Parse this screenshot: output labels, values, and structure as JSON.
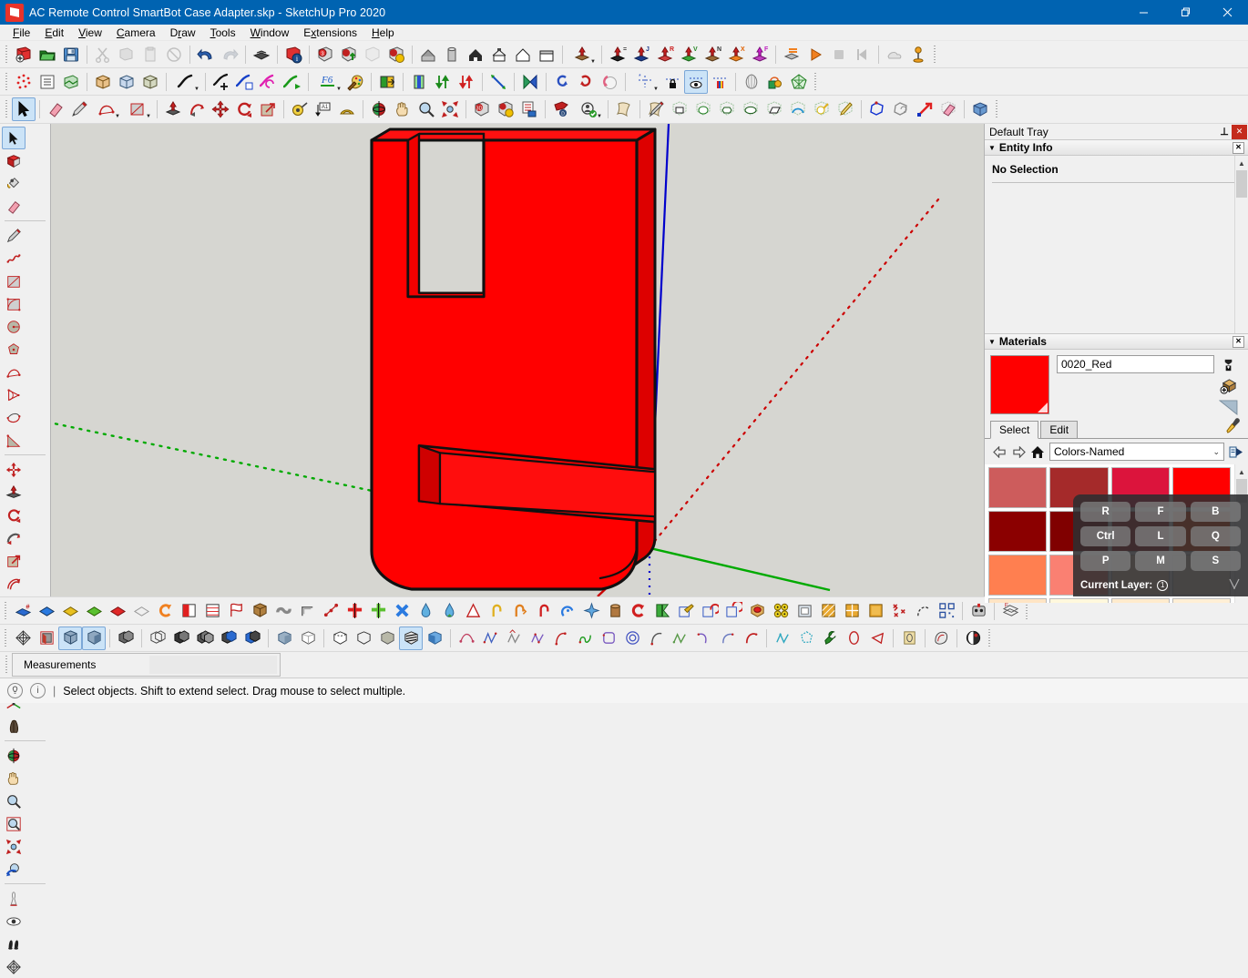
{
  "window": {
    "title": "AC Remote Control SmartBot Case Adapter.skp - SketchUp Pro 2020",
    "app_icon": "sketchup-logo-icon",
    "minimize": "minimize-icon",
    "restore": "restore-icon",
    "close": "close-icon"
  },
  "menubar": {
    "items": [
      {
        "label": "File",
        "mnemonic": "F"
      },
      {
        "label": "Edit",
        "mnemonic": "E"
      },
      {
        "label": "View",
        "mnemonic": "V"
      },
      {
        "label": "Camera",
        "mnemonic": "C"
      },
      {
        "label": "Draw",
        "mnemonic": "D"
      },
      {
        "label": "Tools",
        "mnemonic": "T"
      },
      {
        "label": "Window",
        "mnemonic": "W"
      },
      {
        "label": "Extensions",
        "mnemonic": "x"
      },
      {
        "label": "Help",
        "mnemonic": "H"
      }
    ]
  },
  "tray": {
    "title": "Default Tray",
    "pin_icon": "pin-icon",
    "close_icon": "close-icon",
    "entity_info": {
      "header": "Entity Info",
      "collapse_icon": "triangle-down-icon",
      "close_icon": "close-icon",
      "status": "No Selection"
    },
    "materials": {
      "header": "Materials",
      "collapse_icon": "triangle-down-icon",
      "close_icon": "close-icon",
      "material_name": "0020_Red",
      "material_color": "#FF0000",
      "side_icons": [
        "create-material-icon",
        "paint-bucket-add-icon",
        "display-secondary-icon"
      ],
      "eyedropper_icon": "eyedropper-icon",
      "tabs": [
        {
          "label": "Select",
          "active": true
        },
        {
          "label": "Edit",
          "active": false
        }
      ],
      "nav": {
        "back_icon": "arrow-left-icon",
        "forward_icon": "arrow-right-icon",
        "home_icon": "home-icon",
        "details_icon": "details-arrow-icon"
      },
      "library": "Colors-Named",
      "library_chevron": "chevron-down-icon",
      "swatches": [
        "#CD5C5C",
        "#A52A2A",
        "#DC143C",
        "#FF0000",
        "#8B0000",
        "#800000",
        "#B22222",
        "#FF4500",
        "#FF7F50",
        "#FA8072",
        "#FFDAB9",
        "#FAEBD7",
        "#FFE4C4",
        "#FFF8DC",
        "#FFEBCD",
        "#FFEFD5"
      ],
      "scroll_up_icon": "chevron-up-icon"
    }
  },
  "overlay": {
    "rows": [
      [
        "R",
        "F",
        "B"
      ],
      [
        "Ctrl",
        "L",
        "Q"
      ],
      [
        "P",
        "M",
        "S"
      ]
    ],
    "layer_label": "Current Layer:",
    "layer_value": "1",
    "layer_badge_icon": "circled-number-icon",
    "watermark_icon": "antler-icon"
  },
  "measurements": {
    "label": "Measurements",
    "value": ""
  },
  "statusbar": {
    "help_icon": "lightbulb-icon",
    "info_icon": "info-icon",
    "divider": "|",
    "message": "Select objects. Shift to extend select. Drag mouse to select multiple."
  },
  "viewport": {
    "background_color": "#d6d6d1",
    "model_color": "#FF0000",
    "model_shade_color": "#C00000",
    "model_name": "AC Remote Control SmartBot Case Adapter",
    "axes": {
      "red_axis_color": "#cc0000",
      "green_axis_color": "#00aa00",
      "blue_axis_color": "#0000cc"
    }
  },
  "toolbars": {
    "row1": [
      "new-document-icon",
      "open-folder-icon",
      "save-icon",
      "cut-scissors-icon",
      "copy-icon",
      "paste-icon",
      "erase-icon",
      "undo-icon",
      "redo-icon",
      "print-icon",
      "model-info-icon",
      "component-icon",
      "component-export-icon",
      "component-hidden-icon",
      "component-options-icon",
      "house-gray-icon",
      "cylinder-icon",
      "house-solid-icon",
      "house-box-icon",
      "house-outline-icon",
      "box-open-icon",
      "push-up-menu-icon",
      "push-equal-icon",
      "push-j-icon",
      "push-r-icon",
      "push-v-icon",
      "push-n-icon",
      "push-x-icon",
      "push-f-icon",
      "layers-icon",
      "play-icon",
      "stop-icon",
      "previous-icon",
      "fog-icon",
      "position-pin-icon"
    ],
    "row2": [
      "sandbox-icon",
      "list-icon",
      "terrain-icon",
      "solid-box-icon",
      "solid-union-icon",
      "solid-subtract-icon",
      "freehand-menu-icon",
      "freehand-plus-icon",
      "freehand-edit-icon",
      "freehand-refresh-icon",
      "freehand-arrow-icon",
      "f6-text-icon",
      "paint-palette-icon",
      "material-swap-icon",
      "material-pick-icon",
      "gradient-icon",
      "flip-up-down-icon",
      "flip-down-up-icon",
      "scale-diagonal-icon",
      "mirror-icon",
      "rotate-left-icon",
      "rotate-right-icon",
      "clock-rotate-icon",
      "guide-menu-icon",
      "guide-lock-icon",
      "guide-visible-icon",
      "guide-color-icon",
      "shell-icon",
      "lollipop-icon",
      "mesh-icon"
    ],
    "row3": [
      "select-arrow-icon",
      "eraser-icon",
      "pencil-icon",
      "arc-icon",
      "rectangle-icon",
      "pushpull-icon",
      "followme-icon",
      "move-icon",
      "rotate-icon",
      "scale-icon",
      "tape-measure-icon",
      "dimension-icon",
      "protractor-icon",
      "orbit-icon",
      "pan-icon",
      "zoom-icon",
      "zoom-extents-icon",
      "component-red-icon",
      "component-yellow-icon",
      "component-list-icon",
      "tag-icon",
      "profile-check-icon",
      "page-icon",
      "pencil-tool-icon",
      "shape-rect-icon",
      "shape-circle-icon",
      "shape-polygon-icon",
      "shape-ellipse-icon",
      "shape-parallelogram-icon",
      "shape-arc-icon",
      "shape-pie-icon",
      "shape-cone-icon",
      "outline-blue-icon",
      "outline-gray-icon",
      "arrow-red-icon",
      "eraser-pink-icon",
      "cube-blue-icon"
    ],
    "bottom1": [
      "blue-hash-icon",
      "blue-diamond-icon",
      "yellow-diamond-icon",
      "green-diamond-icon",
      "red-diamond-icon",
      "gray-diamond-icon",
      "orange-arc-icon",
      "red-square-icon",
      "stripe-icon",
      "flag-icon",
      "box-brown-icon",
      "gray-tube-icon",
      "corner-icon",
      "dots-line-icon",
      "red-cross-icon",
      "green-cross-icon",
      "blue-cross-icon",
      "drop-blue-icon",
      "drop-green-icon",
      "triangle-icon",
      "hook-yellow-icon",
      "hook-orange-icon",
      "hook-red-icon",
      "hook-blue-icon",
      "star-icon",
      "barrel-icon",
      "magnet-icon",
      "green-k-icon",
      "box-paint-icon",
      "box-rotate-icon",
      "box-cycle-icon",
      "red-stone-icon",
      "dice-icon",
      "frame-icon",
      "grid-hatch-icon",
      "grid-quad-icon",
      "grid-solid-icon",
      "x-points-icon",
      "curve-icon",
      "qr-icon",
      "robot-icon",
      "layers-stack-icon"
    ],
    "bottom2": [
      "axes-icon",
      "section-plane-icon",
      "section-display-icon",
      "section-fill-icon",
      "group-icon",
      "group-outline-icon",
      "group-dark-icon",
      "group-multi-icon",
      "group-blue-icon",
      "group-blue2-icon",
      "style-shaded-icon",
      "style-wire-icon",
      "style-hidden-icon",
      "style-xray-icon",
      "style-mono-icon",
      "style-texture-icon",
      "style-color-icon",
      "bezier-icon",
      "zigzag-icon",
      "polyline-icon",
      "bezier-red-icon",
      "spline-icon",
      "curve-s-icon",
      "arc-green-icon",
      "rounded-rect-icon",
      "spiral-icon",
      "arc-half-icon",
      "zigzag-green-icon",
      "hook-curve-icon",
      "arc-up-icon",
      "arc-red-icon",
      "polyline-cyan-icon",
      "polygon-dotted-icon",
      "wrench-icon",
      "ellipse-red-icon",
      "triangle-red-icon",
      "card-icon",
      "shape-outline-icon",
      "globe-icon"
    ]
  }
}
